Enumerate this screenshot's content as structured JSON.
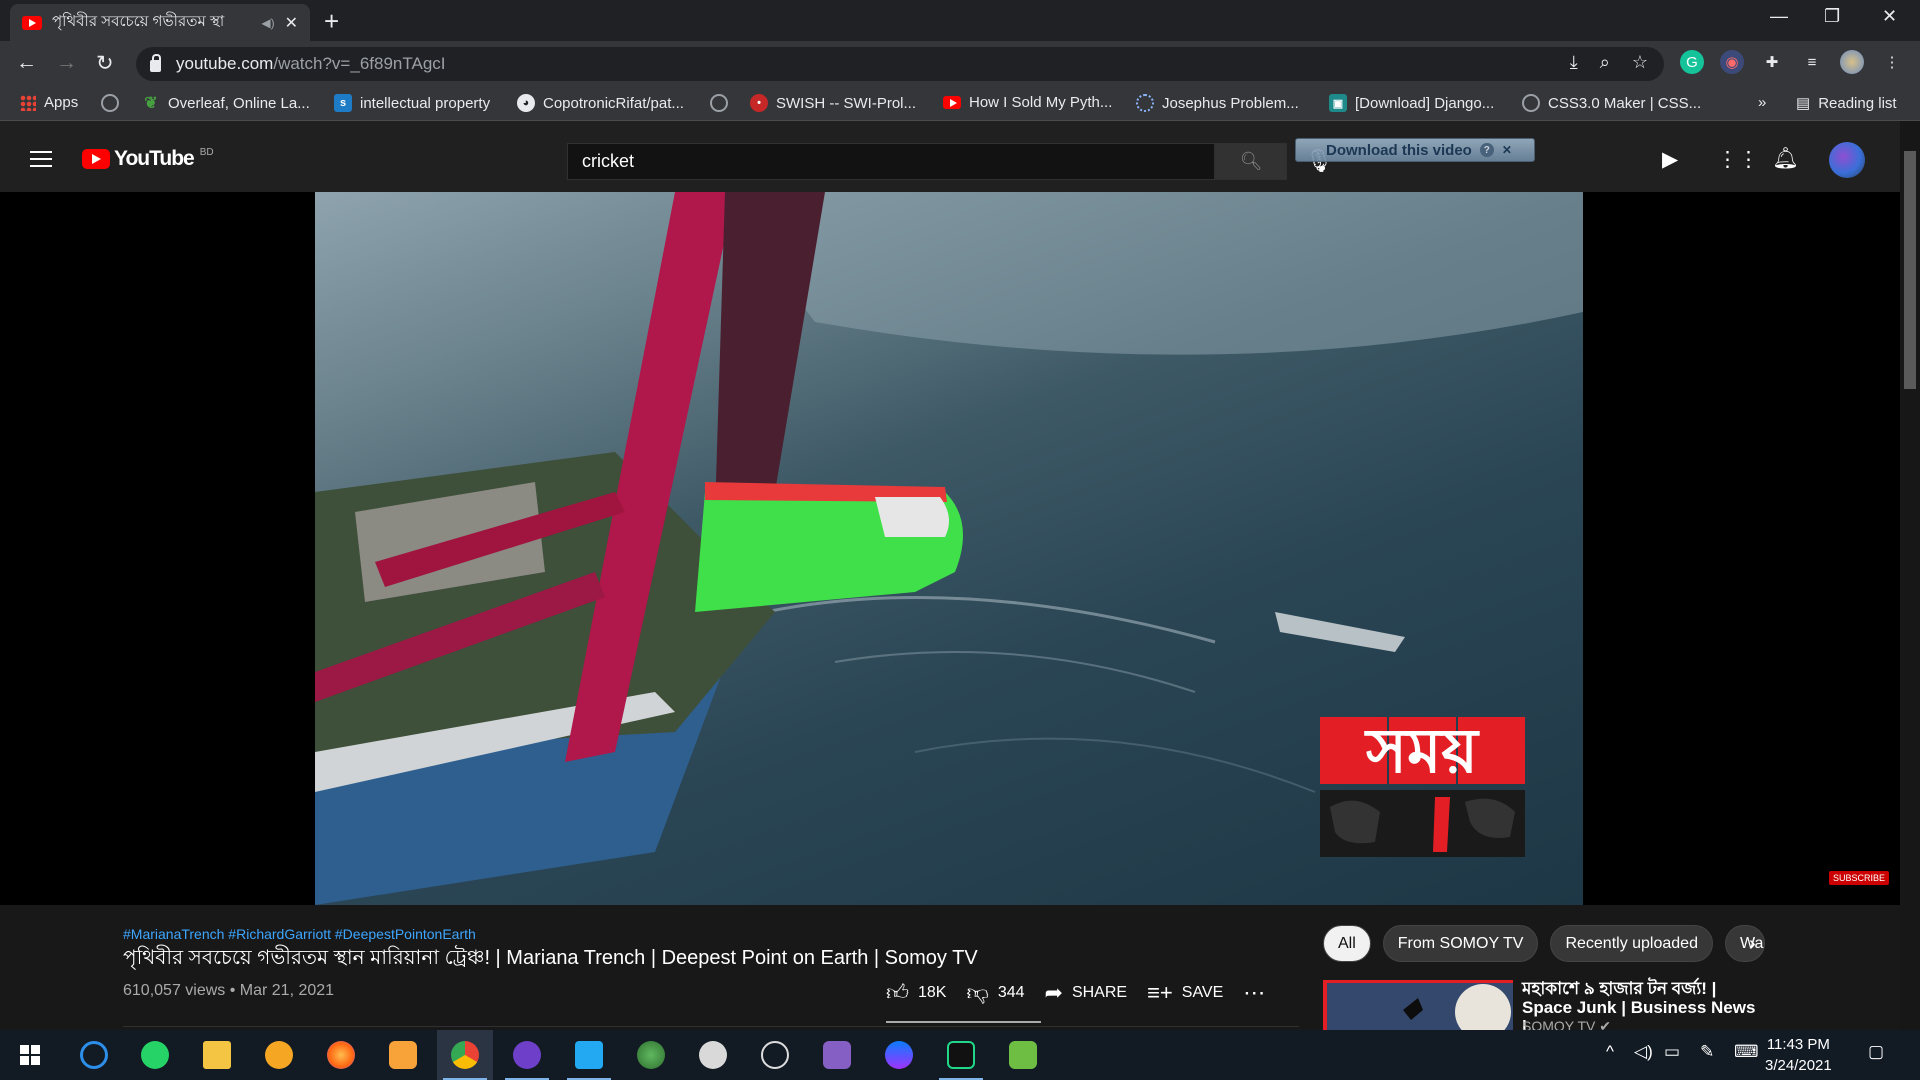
{
  "browser": {
    "tab_title": "পৃথিবীর সবচেয়ে গভীরতম স্থা",
    "url_host": "youtube.com",
    "url_path": "/watch?v=_6f89nTAgcI",
    "bookmarks": [
      {
        "label": "Apps",
        "icon": "apps-grid-icon",
        "color": "#ea4335"
      },
      {
        "label": "",
        "icon": "globe-icon",
        "color": "#9aa0a6"
      },
      {
        "label": "Overleaf, Online La...",
        "icon": "overleaf-icon",
        "color": "#47a141"
      },
      {
        "label": "intellectual property",
        "icon": "scribd-icon",
        "color": "#1e7bc6"
      },
      {
        "label": "CopotronicRifat/pat...",
        "icon": "github-icon",
        "color": "#e8eaed"
      },
      {
        "label": "",
        "icon": "globe-icon",
        "color": "#9aa0a6"
      },
      {
        "label": "SWISH -- SWI-Prol...",
        "icon": "swish-icon",
        "color": "#c62828"
      },
      {
        "label": "How I Sold My Pyth...",
        "icon": "youtube-icon",
        "color": "#ff0000"
      },
      {
        "label": "Josephus Problem...",
        "icon": "loading-icon",
        "color": "#5f6368"
      },
      {
        "label": "[Download] Django...",
        "icon": "django-icon",
        "color": "#1e8a8a"
      },
      {
        "label": "CSS3.0 Maker | CSS...",
        "icon": "globe-icon",
        "color": "#9aa0a6"
      }
    ],
    "reading_list": "Reading list",
    "more_bookmarks": "»"
  },
  "youtube": {
    "logo_text": "YouTube",
    "country_code": "BD",
    "search_value": "cricket",
    "download_widget": "Download this video",
    "video": {
      "hashtags": "#MarianaTrench #RichardGarriott #DeepestPointonEarth",
      "title": "পৃথিবীর সবচেয়ে গভীরতম স্থান মারিয়ানা ট্রেঞ্চ! | Mariana Trench | Deepest Point on Earth | Somoy TV",
      "meta": "610,057 views • Mar 21, 2021",
      "likes": "18K",
      "dislikes": "344",
      "share": "SHARE",
      "save": "SAVE",
      "watermark_text": "সময়",
      "subscribe_watermark": "SUBSCRIBE"
    },
    "chips": [
      "All",
      "From SOMOY TV",
      "Recently uploaded",
      "Wa"
    ],
    "recommended": {
      "title": "মহাকাশে ৯ হাজার টন বর্জ্য! | Space Junk | Business News |...",
      "channel": "SOMOY TV ✔"
    }
  },
  "taskbar": {
    "apps": [
      "windows-start-icon",
      "sync-icon",
      "whatsapp-icon",
      "file-explorer-icon",
      "vpn-icon",
      "firefox-icon",
      "notes-icon",
      "chrome-icon",
      "github-desktop-icon",
      "vscode-icon",
      "spyder-icon",
      "anaconda-icon",
      "satellite-icon",
      "visual-studio-icon",
      "messenger-icon",
      "pycharm-icon",
      "sheets-icon"
    ],
    "time": "11:43 PM",
    "date": "3/24/2021"
  }
}
